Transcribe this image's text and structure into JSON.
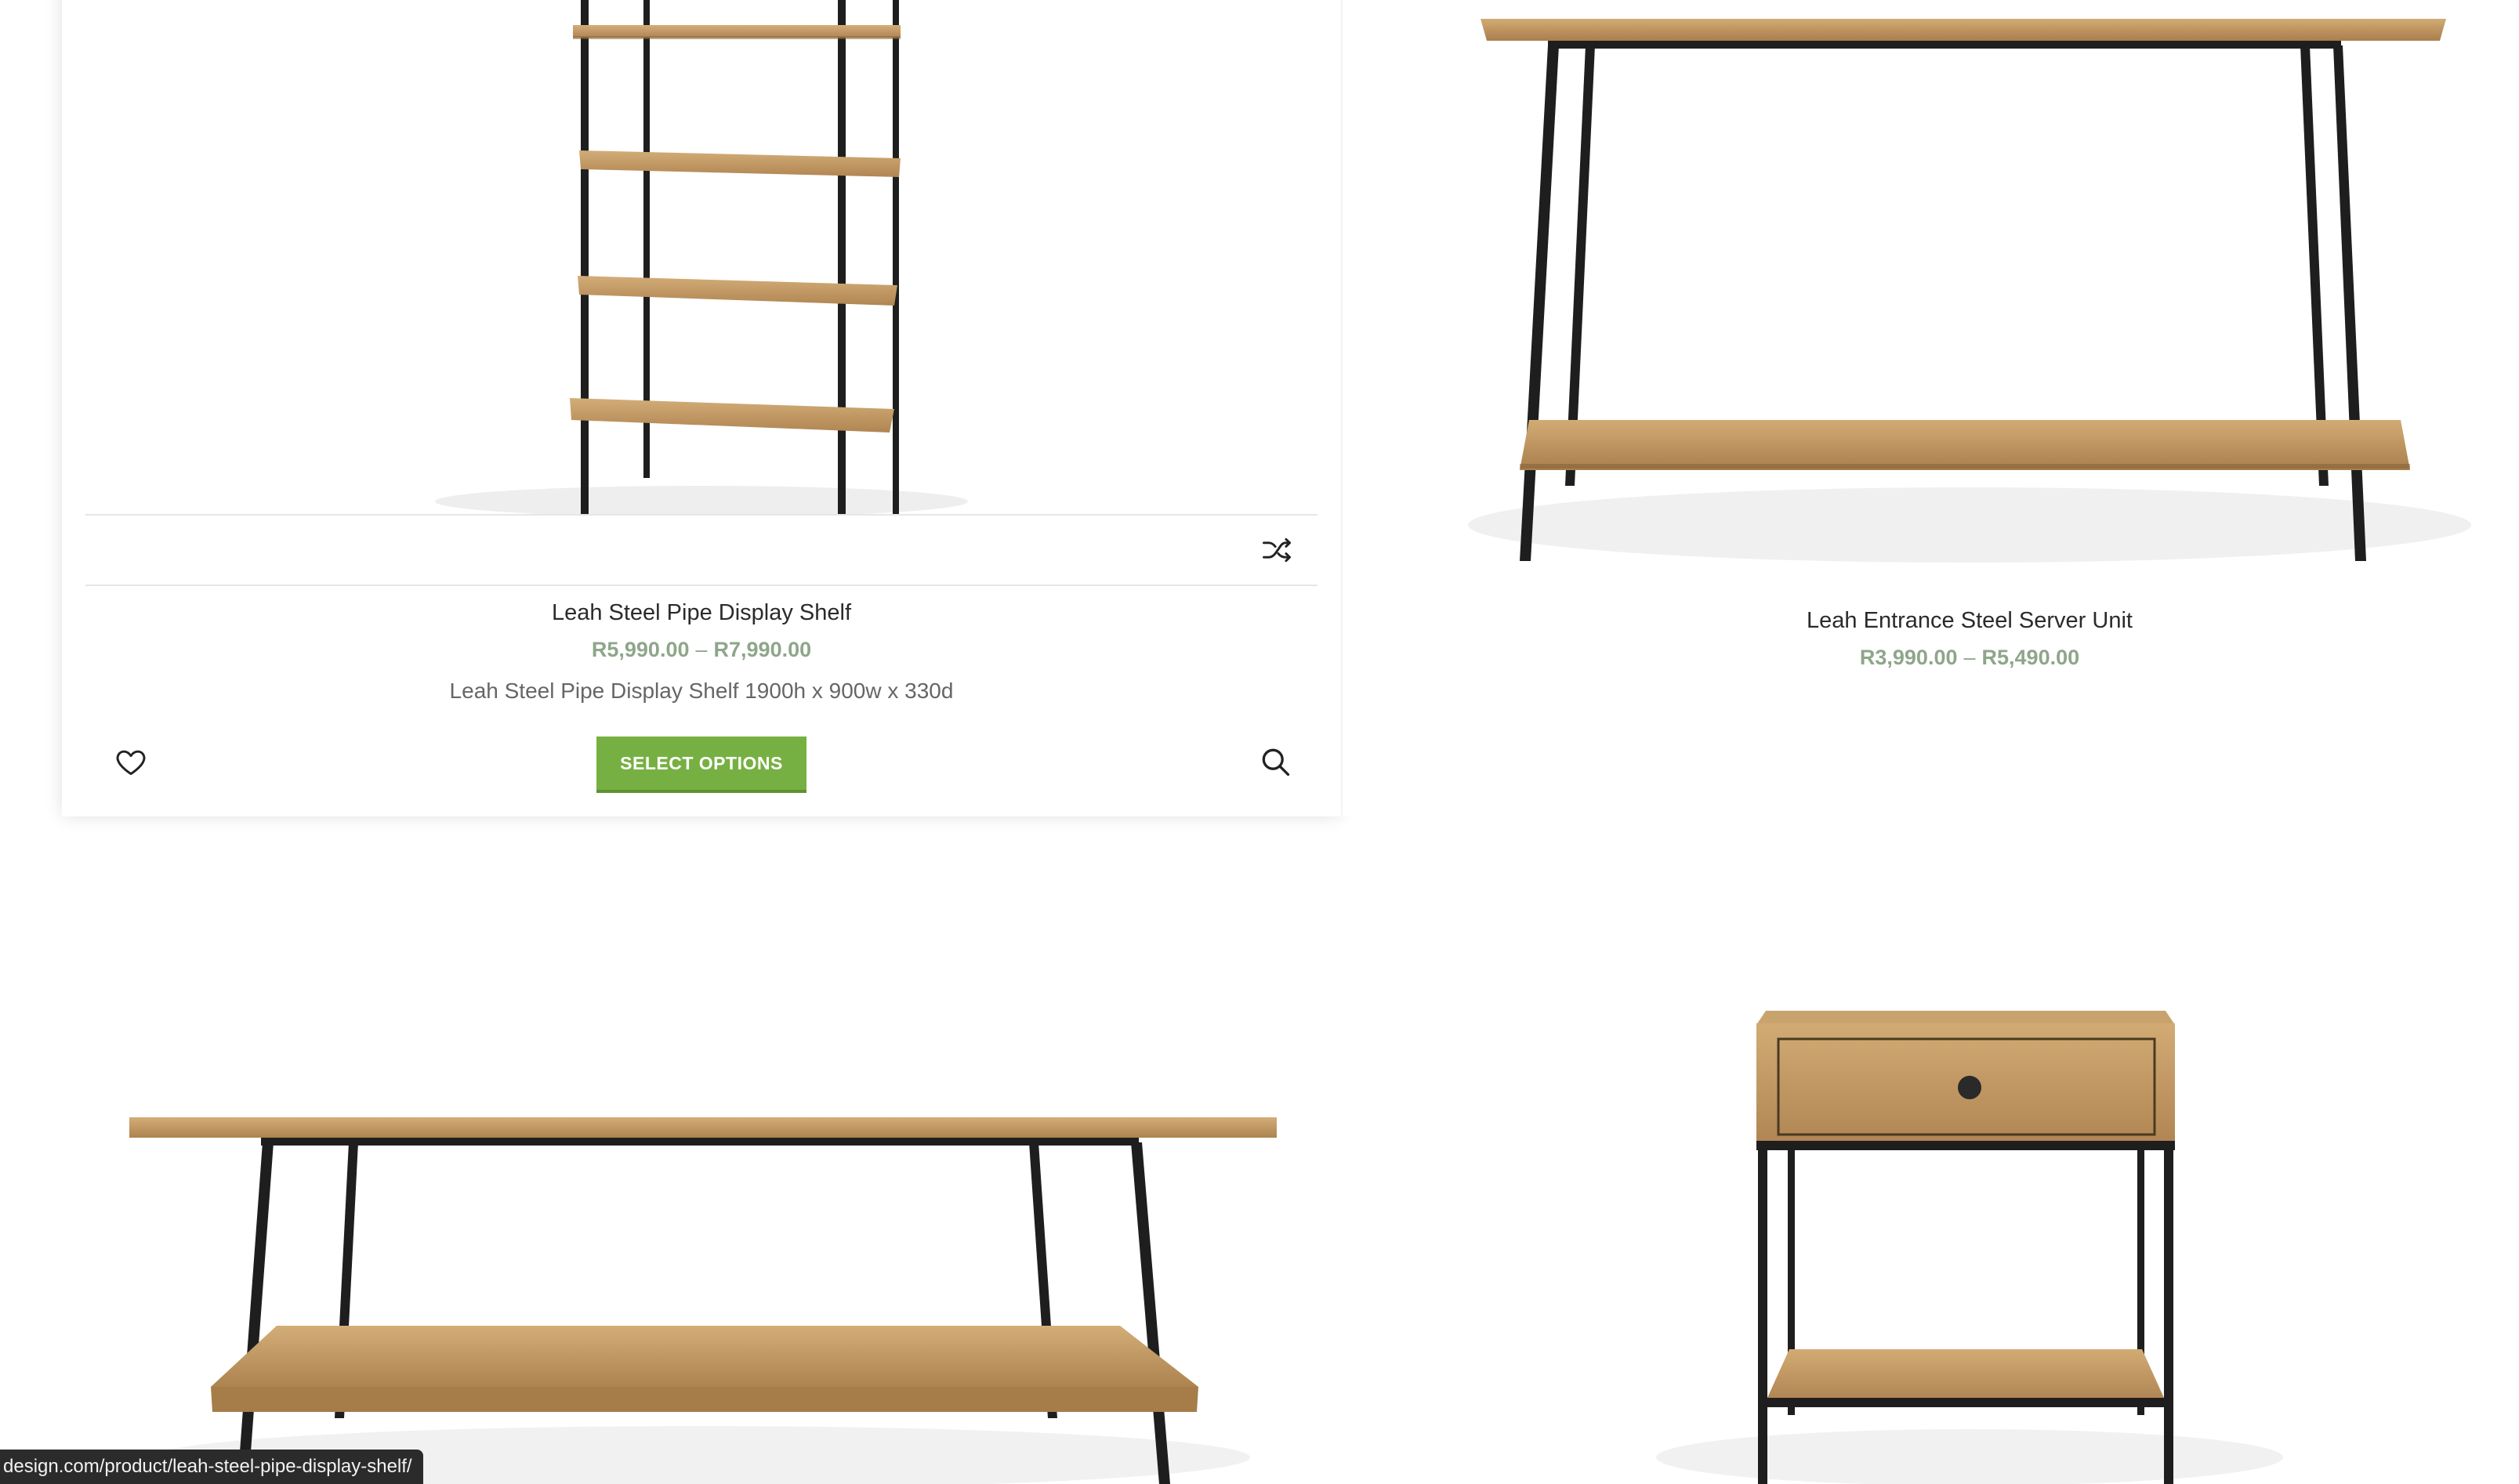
{
  "products": [
    {
      "title": "Leah Steel Pipe Display Shelf",
      "price_min": "R5,990.00",
      "price_sep": "–",
      "price_max": "R7,990.00",
      "description": "Leah Steel Pipe Display Shelf 1900h x 900w x 330d",
      "button_label": "SELECT OPTIONS",
      "icons": [
        "shuffle-icon",
        "heart-icon",
        "search-icon"
      ]
    },
    {
      "title": "Leah Entrance Steel Server Unit",
      "price_min": "R3,990.00",
      "price_sep": "–",
      "price_max": "R5,490.00"
    },
    {
      "title": "",
      "image": "coffee-table-image"
    },
    {
      "title": "",
      "image": "bedside-table-image"
    }
  ],
  "status_bar": {
    "url": "design.com/product/leah-steel-pipe-display-shelf/"
  },
  "colors": {
    "price": "#8ea68a",
    "button": "#77b042",
    "wood": "#c8a06a",
    "steel": "#1e1e1e"
  }
}
